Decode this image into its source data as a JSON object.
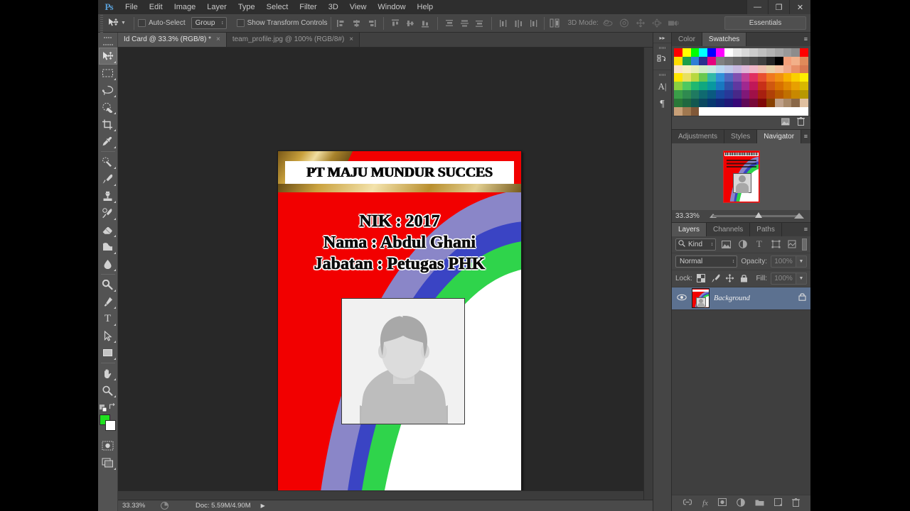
{
  "app": {
    "logo": "Ps",
    "menus": [
      "File",
      "Edit",
      "Image",
      "Layer",
      "Type",
      "Select",
      "Filter",
      "3D",
      "View",
      "Window",
      "Help"
    ],
    "window_controls": {
      "minimize": "—",
      "restore": "❐",
      "close": "✕"
    }
  },
  "options_bar": {
    "tool_icon": "move-tool-icon",
    "auto_select_label": "Auto-Select",
    "auto_select_checked": false,
    "group_value": "Group",
    "show_transform_label": "Show Transform Controls",
    "show_transform_checked": false,
    "mode3d_label": "3D Mode:",
    "workspace": "Essentials"
  },
  "toolbox": {
    "tools": [
      {
        "name": "move-tool",
        "active": true
      },
      {
        "name": "rectangular-marquee-tool",
        "active": false
      },
      {
        "name": "lasso-tool",
        "active": false
      },
      {
        "name": "quick-selection-tool",
        "active": false
      },
      {
        "name": "crop-tool",
        "active": false
      },
      {
        "name": "eyedropper-tool",
        "active": false
      },
      {
        "name": "spot-healing-brush-tool",
        "active": false
      },
      {
        "name": "brush-tool",
        "active": false
      },
      {
        "name": "clone-stamp-tool",
        "active": false
      },
      {
        "name": "history-brush-tool",
        "active": false
      },
      {
        "name": "eraser-tool",
        "active": false
      },
      {
        "name": "gradient-tool",
        "active": false
      },
      {
        "name": "blur-tool",
        "active": false
      },
      {
        "name": "dodge-tool",
        "active": false
      },
      {
        "name": "pen-tool",
        "active": false
      },
      {
        "name": "horizontal-type-tool",
        "active": false,
        "glyph": "T"
      },
      {
        "name": "path-selection-tool",
        "active": false
      },
      {
        "name": "rectangle-tool",
        "active": false
      },
      {
        "name": "hand-tool",
        "active": false
      },
      {
        "name": "zoom-tool",
        "active": false
      }
    ],
    "foreground_color": "#1fe01f",
    "background_color": "#ffffff"
  },
  "tabs": [
    {
      "label": "Id Card @ 33.3% (RGB/8) *",
      "active": true,
      "close": "×"
    },
    {
      "label": "team_profile.jpg @ 100% (RGB/8#)",
      "active": false,
      "close": "×"
    }
  ],
  "status_bar": {
    "zoom": "33.33%",
    "doc": "Doc: 5.59M/4.90M",
    "arrow": "▶"
  },
  "card": {
    "company": "PT MAJU MUNDUR SUCCES",
    "fields": [
      "NIK : 2017",
      "Nama : Abdul Ghani",
      "Jabatan : Petugas PHK"
    ],
    "photo_alt": "employee-photo-placeholder",
    "colors": {
      "red": "#f20000",
      "green": "#2fd44b",
      "purple": "#8a86c8",
      "blue": "#3a44c4",
      "white": "#ffffff",
      "gold": "#c8a03c"
    }
  },
  "dock_rail": {
    "collapse": "▸▸",
    "icons": [
      "history-icon",
      "character-icon",
      "paragraph-icon"
    ],
    "character_glyph": "A|",
    "paragraph_glyph": "¶"
  },
  "color_panel": {
    "tabs": [
      {
        "label": "Color",
        "active": false
      },
      {
        "label": "Swatches",
        "active": true
      }
    ],
    "menu": "≡",
    "footer_icons": [
      "new-swatch-icon",
      "delete-swatch-icon"
    ],
    "swatches": [
      "#ff0000",
      "#ffff00",
      "#00ff00",
      "#00ffff",
      "#0000ff",
      "#ff00ff",
      "#ffffff",
      "#e6e6e6",
      "#d9d9d9",
      "#cccccc",
      "#bfbfbf",
      "#b3b3b3",
      "#a6a6a6",
      "#999999",
      "#8c8c8c",
      "#ff0000",
      "#ffdd00",
      "#1e9e4a",
      "#2f7fd6",
      "#2a2f8f",
      "#e6007e",
      "#808080",
      "#737373",
      "#666666",
      "#595959",
      "#4d4d4d",
      "#404040",
      "#262626",
      "#000000",
      "#f4a07a",
      "#f2b089",
      "#e08a5a",
      "#fae3c8",
      "#f7efc0",
      "#e8f0b8",
      "#d2ecc8",
      "#c8e8e0",
      "#b8d8f0",
      "#c0c8e8",
      "#c8b8e0",
      "#e0b8d8",
      "#f0b8c8",
      "#f0c0b0",
      "#e8d0a8",
      "#f5c0a0",
      "#f0a888",
      "#e89068",
      "#d87850",
      "#ffe600",
      "#e8e060",
      "#b8d840",
      "#68c850",
      "#30b8a8",
      "#3090d8",
      "#5068c0",
      "#8050b0",
      "#c04098",
      "#e03060",
      "#e85030",
      "#f07820",
      "#f09010",
      "#f8b000",
      "#fad000",
      "#ffee00",
      "#8ad040",
      "#4ec860",
      "#20b870",
      "#10a880",
      "#0898a0",
      "#1878c0",
      "#3050a8",
      "#6038a0",
      "#a02890",
      "#c01858",
      "#c83018",
      "#d05810",
      "#d87000",
      "#e08800",
      "#e8a000",
      "#d8b800",
      "#3a9e48",
      "#2f8a50",
      "#1f7a60",
      "#0f6a70",
      "#0a5a80",
      "#18489e",
      "#283898",
      "#482888",
      "#801878",
      "#a01048",
      "#a82010",
      "#b04008",
      "#b85800",
      "#c07000",
      "#c88800",
      "#b89800",
      "#2a7838",
      "#1f6840",
      "#135850",
      "#0a4860",
      "#063870",
      "#102878",
      "#201878",
      "#380878",
      "#600858",
      "#780838",
      "#800808",
      "#884000",
      "#bfa088",
      "#a88868",
      "#8a6848",
      "#e0c0a0",
      "#c8a078",
      "#a07850",
      "#805838",
      "#ffffff",
      "#ffffff",
      "#ffffff",
      "#ffffff",
      "#ffffff",
      "#ffffff",
      "#ffffff",
      "#ffffff",
      "#ffffff",
      "#ffffff",
      "#ffffff",
      "#ffffff",
      "#ffffff"
    ]
  },
  "navigator_panel": {
    "tabs": [
      {
        "label": "Adjustments",
        "active": false
      },
      {
        "label": "Styles",
        "active": false
      },
      {
        "label": "Navigator",
        "active": true
      }
    ],
    "menu": "≡",
    "zoom_value": "33.33%"
  },
  "layers_panel": {
    "tabs": [
      {
        "label": "Layers",
        "active": true
      },
      {
        "label": "Channels",
        "active": false
      },
      {
        "label": "Paths",
        "active": false
      }
    ],
    "menu": "≡",
    "filter_label": "Kind",
    "filter_icon": "search-icon",
    "filter_type_icons": [
      "image-filter-icon",
      "adjustment-filter-icon",
      "type-filter-icon",
      "shape-filter-icon",
      "smart-object-filter-icon"
    ],
    "blend_mode": "Normal",
    "opacity_label": "Opacity:",
    "opacity_value": "100%",
    "lock_label": "Lock:",
    "lock_icons": [
      "lock-transparent-icon",
      "lock-image-icon",
      "lock-position-icon",
      "lock-all-icon"
    ],
    "fill_label": "Fill:",
    "fill_value": "100%",
    "layers": [
      {
        "name": "Background",
        "visible": true,
        "locked": true,
        "selected": true
      }
    ],
    "footer_icons": [
      "link-layers-icon",
      "layer-style-icon",
      "layer-mask-icon",
      "adjustment-layer-icon",
      "new-group-icon",
      "new-layer-icon",
      "delete-layer-icon"
    ],
    "footer_glyphs": [
      "⚭",
      "fx",
      "▣",
      "◐",
      "▰",
      "❐",
      "Ὕ1"
    ]
  }
}
